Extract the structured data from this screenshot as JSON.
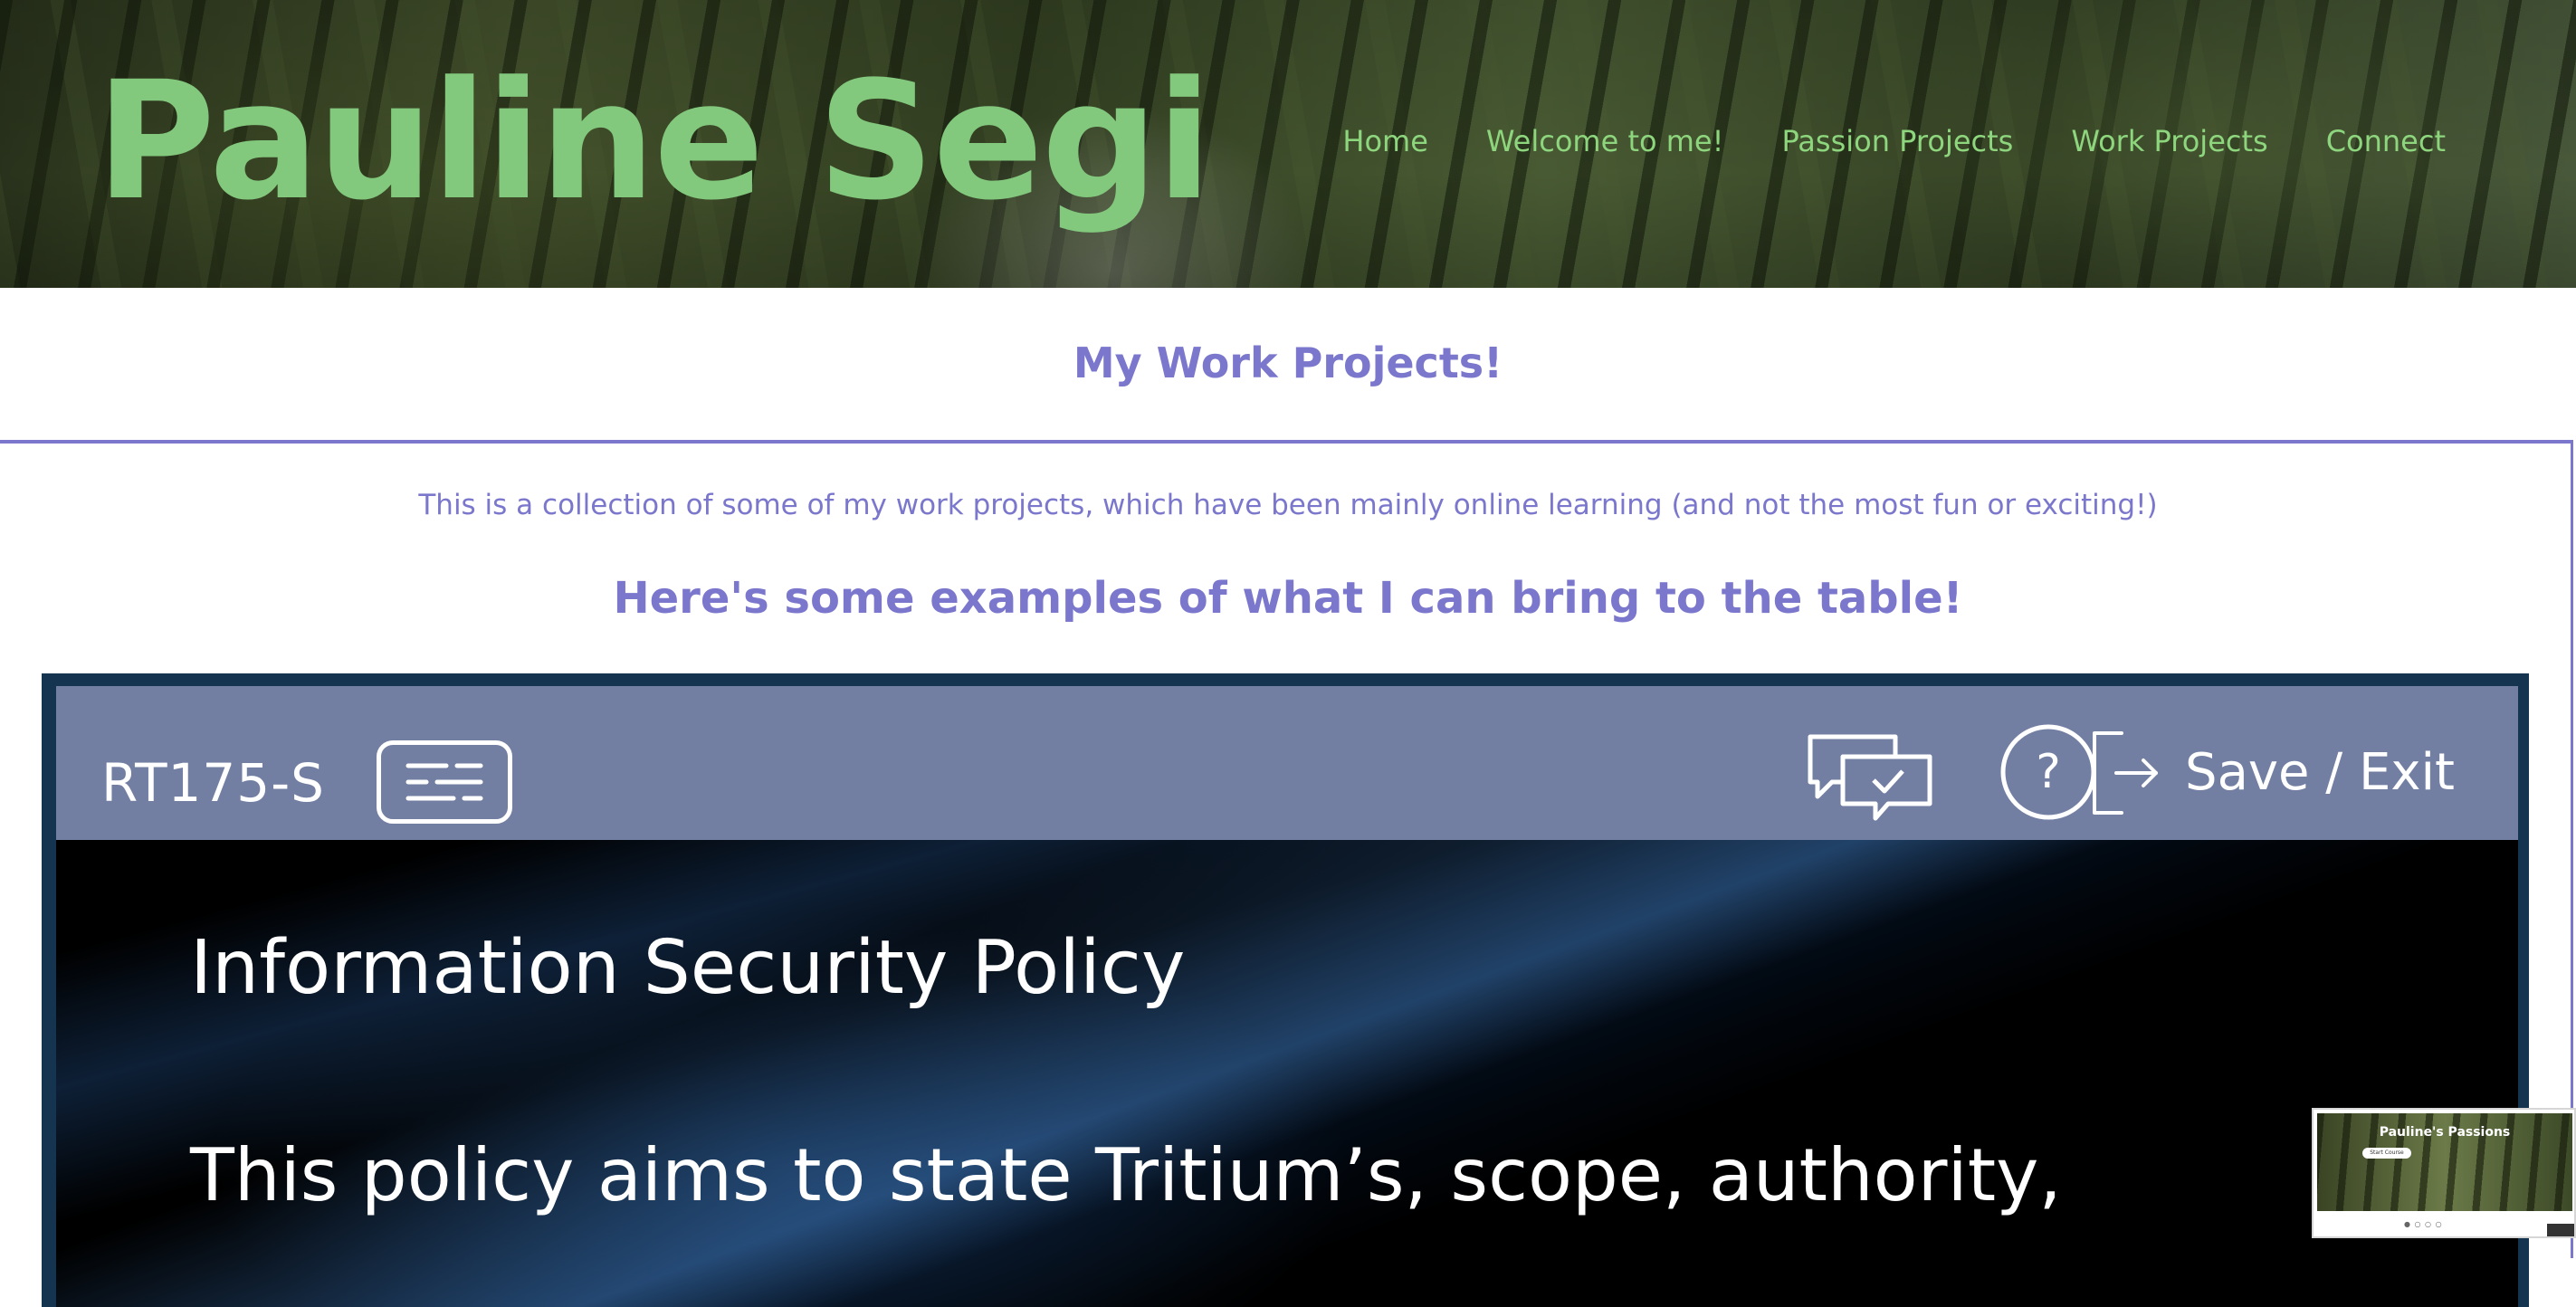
{
  "site": {
    "title": "Pauline Segi"
  },
  "nav": {
    "items": [
      {
        "label": "Home"
      },
      {
        "label": "Welcome to me!"
      },
      {
        "label": "Passion Projects"
      },
      {
        "label": "Work Projects"
      },
      {
        "label": "Connect"
      }
    ]
  },
  "main": {
    "heading": "My Work Projects!",
    "intro": "This is a collection of some of my work projects, which have been mainly online learning (and not the most fun or exciting!)",
    "subheading": "Here's some examples of what I can bring to the table!"
  },
  "embed": {
    "course_code": "RT175-S",
    "transcript_icon": "transcript-icon",
    "discussion_icon": "discussion-icon",
    "help_icon": "help-icon",
    "exit_icon": "exit-icon",
    "save_exit_label": "Save / Exit",
    "slide_title": "Information Security Policy",
    "slide_body": "This policy aims to state Tritium’s, scope, authority,"
  },
  "thumbnail": {
    "title": "Pauline's Passions",
    "button_label": "Start Course",
    "dots": "● ○ ○ ○"
  },
  "colors": {
    "title_green": "#82c87d",
    "nav_green": "#8ed67e",
    "accent_purple": "#7a77cc",
    "toolbar_blue": "#727fa3",
    "embed_border": "#143450"
  }
}
